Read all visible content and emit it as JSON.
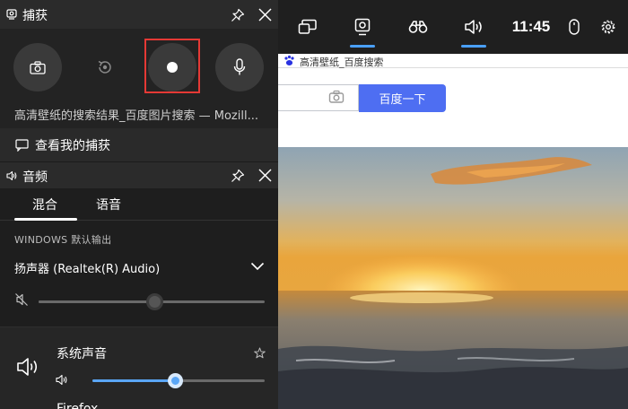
{
  "browser": {
    "tab_title": "高清壁纸_百度搜索",
    "search_button_label": "百度一下"
  },
  "topbar": {
    "time": "11:45",
    "items": [
      {
        "name": "widget-menu-icon",
        "active": false
      },
      {
        "name": "capture-icon",
        "active": true
      },
      {
        "name": "binoculars-icon",
        "active": false
      },
      {
        "name": "audio-icon",
        "active": true
      },
      {
        "name": "mouse-icon",
        "active": false
      },
      {
        "name": "gear-icon",
        "active": false
      }
    ]
  },
  "capture": {
    "title": "捕获",
    "buttons": [
      "screenshot",
      "record-last",
      "start-recording",
      "microphone"
    ],
    "highlighted": "start-recording",
    "current_window": "高清壁纸的搜索结果_百度图片搜索 — Mozill...",
    "gallery_label": "查看我的捕获"
  },
  "audio": {
    "title": "音频",
    "tabs": [
      "混合",
      "语音"
    ],
    "active_tab": "混合",
    "section_label": "WINDOWS 默认输出",
    "device": "扬声器 (Realtek(R) Audio)",
    "master_volume": 0.51,
    "master_muted": true,
    "apps": [
      {
        "name": "系统声音",
        "volume": 0.48
      },
      {
        "name": "Firefox",
        "volume": null
      }
    ]
  },
  "colors": {
    "accent": "#4aa0ff",
    "highlight_border": "#e53935",
    "baidu_blue": "#4e6ef2"
  }
}
